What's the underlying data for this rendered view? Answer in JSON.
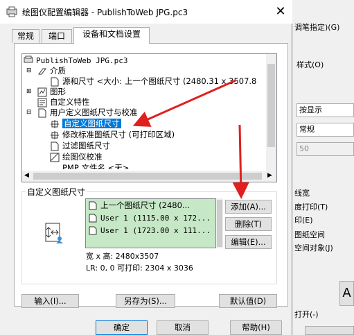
{
  "dialog": {
    "title": "绘图仪配置编辑器 - PublishToWeb JPG.pc3",
    "tabs": [
      "常规",
      "端口",
      "设备和文档设置"
    ],
    "tree": {
      "root": "PublishToWeb JPG.pc3",
      "items": [
        {
          "label": "介质"
        },
        {
          "label": "源和尺寸 <大小: 上一个图纸尺寸 (2480.31 x 3507.8"
        },
        {
          "label": "图形"
        },
        {
          "label": "自定义特性"
        },
        {
          "label": "用户定义图纸尺寸与校准"
        },
        {
          "label": "自定义图纸尺寸",
          "selected": true
        },
        {
          "label": "修改标准图纸尺寸 (可打印区域)"
        },
        {
          "label": "过滤图纸尺寸"
        },
        {
          "label": "绘图仪校准"
        },
        {
          "label": "PMP 文件名 <无>"
        }
      ]
    },
    "custom_group": {
      "label": "自定义图纸尺寸",
      "list": [
        "上一个图纸尺寸 (2480...",
        "User 1 (1115.00 x 172...",
        "User 1 (1723.00 x 111..."
      ],
      "add": "添加(A)...",
      "delete": "删除(T)",
      "edit": "编辑(E)...",
      "size_line": "宽 x 高: 2480x3507",
      "lr_line": "LR: 0, 0  可打印: 2304 x 3036"
    },
    "buttons": {
      "import": "输入(I)...",
      "saveas": "另存为(S)...",
      "defaults": "默认值(D)"
    },
    "footer": {
      "ok": "确定",
      "cancel": "取消",
      "help": "帮助(H)"
    }
  },
  "background": {
    "right_labels": [
      "调笔指定)(G)",
      "样式(O)",
      "线宽",
      "度打印(T)",
      "印(E)",
      "图纸空间",
      "空间对象(J)",
      "打开(-)"
    ],
    "field_display": "按显示",
    "field_quality": "常规",
    "field_dpi": "50",
    "left_chars": [
      "下",
      "工",
      "冂",
      "文",
      "区",
      "刁",
      "下"
    ],
    "corner_char": "A"
  }
}
